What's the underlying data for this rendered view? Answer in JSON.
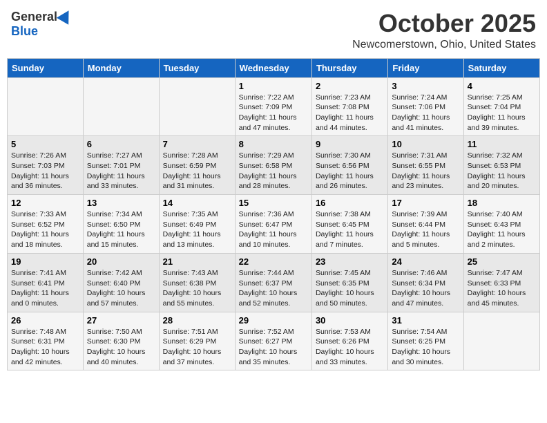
{
  "header": {
    "logo_general": "General",
    "logo_blue": "Blue",
    "month": "October 2025",
    "location": "Newcomerstown, Ohio, United States"
  },
  "weekdays": [
    "Sunday",
    "Monday",
    "Tuesday",
    "Wednesday",
    "Thursday",
    "Friday",
    "Saturday"
  ],
  "weeks": [
    [
      {
        "day": "",
        "info": ""
      },
      {
        "day": "",
        "info": ""
      },
      {
        "day": "",
        "info": ""
      },
      {
        "day": "1",
        "info": "Sunrise: 7:22 AM\nSunset: 7:09 PM\nDaylight: 11 hours and 47 minutes."
      },
      {
        "day": "2",
        "info": "Sunrise: 7:23 AM\nSunset: 7:08 PM\nDaylight: 11 hours and 44 minutes."
      },
      {
        "day": "3",
        "info": "Sunrise: 7:24 AM\nSunset: 7:06 PM\nDaylight: 11 hours and 41 minutes."
      },
      {
        "day": "4",
        "info": "Sunrise: 7:25 AM\nSunset: 7:04 PM\nDaylight: 11 hours and 39 minutes."
      }
    ],
    [
      {
        "day": "5",
        "info": "Sunrise: 7:26 AM\nSunset: 7:03 PM\nDaylight: 11 hours and 36 minutes."
      },
      {
        "day": "6",
        "info": "Sunrise: 7:27 AM\nSunset: 7:01 PM\nDaylight: 11 hours and 33 minutes."
      },
      {
        "day": "7",
        "info": "Sunrise: 7:28 AM\nSunset: 6:59 PM\nDaylight: 11 hours and 31 minutes."
      },
      {
        "day": "8",
        "info": "Sunrise: 7:29 AM\nSunset: 6:58 PM\nDaylight: 11 hours and 28 minutes."
      },
      {
        "day": "9",
        "info": "Sunrise: 7:30 AM\nSunset: 6:56 PM\nDaylight: 11 hours and 26 minutes."
      },
      {
        "day": "10",
        "info": "Sunrise: 7:31 AM\nSunset: 6:55 PM\nDaylight: 11 hours and 23 minutes."
      },
      {
        "day": "11",
        "info": "Sunrise: 7:32 AM\nSunset: 6:53 PM\nDaylight: 11 hours and 20 minutes."
      }
    ],
    [
      {
        "day": "12",
        "info": "Sunrise: 7:33 AM\nSunset: 6:52 PM\nDaylight: 11 hours and 18 minutes."
      },
      {
        "day": "13",
        "info": "Sunrise: 7:34 AM\nSunset: 6:50 PM\nDaylight: 11 hours and 15 minutes."
      },
      {
        "day": "14",
        "info": "Sunrise: 7:35 AM\nSunset: 6:49 PM\nDaylight: 11 hours and 13 minutes."
      },
      {
        "day": "15",
        "info": "Sunrise: 7:36 AM\nSunset: 6:47 PM\nDaylight: 11 hours and 10 minutes."
      },
      {
        "day": "16",
        "info": "Sunrise: 7:38 AM\nSunset: 6:45 PM\nDaylight: 11 hours and 7 minutes."
      },
      {
        "day": "17",
        "info": "Sunrise: 7:39 AM\nSunset: 6:44 PM\nDaylight: 11 hours and 5 minutes."
      },
      {
        "day": "18",
        "info": "Sunrise: 7:40 AM\nSunset: 6:43 PM\nDaylight: 11 hours and 2 minutes."
      }
    ],
    [
      {
        "day": "19",
        "info": "Sunrise: 7:41 AM\nSunset: 6:41 PM\nDaylight: 11 hours and 0 minutes."
      },
      {
        "day": "20",
        "info": "Sunrise: 7:42 AM\nSunset: 6:40 PM\nDaylight: 10 hours and 57 minutes."
      },
      {
        "day": "21",
        "info": "Sunrise: 7:43 AM\nSunset: 6:38 PM\nDaylight: 10 hours and 55 minutes."
      },
      {
        "day": "22",
        "info": "Sunrise: 7:44 AM\nSunset: 6:37 PM\nDaylight: 10 hours and 52 minutes."
      },
      {
        "day": "23",
        "info": "Sunrise: 7:45 AM\nSunset: 6:35 PM\nDaylight: 10 hours and 50 minutes."
      },
      {
        "day": "24",
        "info": "Sunrise: 7:46 AM\nSunset: 6:34 PM\nDaylight: 10 hours and 47 minutes."
      },
      {
        "day": "25",
        "info": "Sunrise: 7:47 AM\nSunset: 6:33 PM\nDaylight: 10 hours and 45 minutes."
      }
    ],
    [
      {
        "day": "26",
        "info": "Sunrise: 7:48 AM\nSunset: 6:31 PM\nDaylight: 10 hours and 42 minutes."
      },
      {
        "day": "27",
        "info": "Sunrise: 7:50 AM\nSunset: 6:30 PM\nDaylight: 10 hours and 40 minutes."
      },
      {
        "day": "28",
        "info": "Sunrise: 7:51 AM\nSunset: 6:29 PM\nDaylight: 10 hours and 37 minutes."
      },
      {
        "day": "29",
        "info": "Sunrise: 7:52 AM\nSunset: 6:27 PM\nDaylight: 10 hours and 35 minutes."
      },
      {
        "day": "30",
        "info": "Sunrise: 7:53 AM\nSunset: 6:26 PM\nDaylight: 10 hours and 33 minutes."
      },
      {
        "day": "31",
        "info": "Sunrise: 7:54 AM\nSunset: 6:25 PM\nDaylight: 10 hours and 30 minutes."
      },
      {
        "day": "",
        "info": ""
      }
    ]
  ]
}
